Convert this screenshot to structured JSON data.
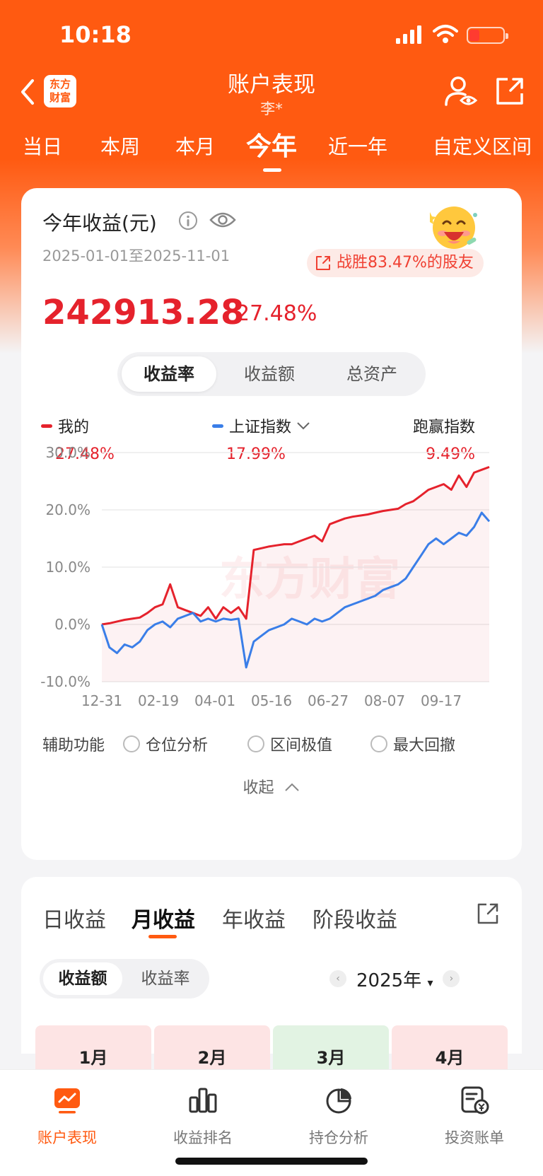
{
  "status": {
    "time": "10:18"
  },
  "header": {
    "logo_line1": "东方",
    "logo_line2": "财富",
    "title": "账户表现",
    "subtitle": "李*"
  },
  "period_tabs": [
    "当日",
    "本周",
    "本月",
    "今年",
    "近一年",
    "自定义区间"
  ],
  "period_tabs_active": "今年",
  "summary": {
    "title": "今年收益(元)",
    "date_range": "2025-01-01至2025-11-01",
    "beat_text": "战胜83.47%的股友",
    "profit": "242913.28",
    "profit_pct": "27.48%"
  },
  "metric_tabs": [
    "收益率",
    "收益额",
    "总资产"
  ],
  "metric_tabs_active": "收益率",
  "legend": {
    "mine_label": "我的",
    "mine_value": "27.48%",
    "index_label": "上证指数",
    "index_value": "17.99%",
    "beat_label": "跑赢指数",
    "beat_value": "9.49%"
  },
  "colors": {
    "accent": "#ff5a11",
    "up_red": "#e5222c",
    "index_blue": "#3a7ee8"
  },
  "chart_data": {
    "type": "line",
    "watermark": "东方财富",
    "x_tick_labels": [
      "12-31",
      "02-19",
      "04-01",
      "05-16",
      "06-27",
      "08-07",
      "09-17"
    ],
    "y_tick_labels": [
      "30.0%",
      "20.0%",
      "10.0%",
      "0.0%",
      "-10.0%"
    ],
    "ylim": [
      -10,
      30
    ],
    "grid": true,
    "series": [
      {
        "name": "我的",
        "color": "#e5222c",
        "values": [
          0,
          0.2,
          0.5,
          0.8,
          1.0,
          1.2,
          2.0,
          3.0,
          3.5,
          7.0,
          3.0,
          2.5,
          2.0,
          1.5,
          3.0,
          1.0,
          3.0,
          2.0,
          3.0,
          1.0,
          13.0,
          13.3,
          13.6,
          13.8,
          14.0,
          14.0,
          14.5,
          15.0,
          15.5,
          14.5,
          17.5,
          18.0,
          18.5,
          18.8,
          19.0,
          19.2,
          19.5,
          19.8,
          20.0,
          20.2,
          21.0,
          21.5,
          22.5,
          23.5,
          24.0,
          24.5,
          23.5,
          26.0,
          24.0,
          26.5,
          27.0,
          27.48
        ]
      },
      {
        "name": "上证指数",
        "color": "#3a7ee8",
        "values": [
          0,
          -4.0,
          -5.0,
          -3.5,
          -4.0,
          -3.0,
          -1.0,
          0,
          0.5,
          -0.5,
          1.0,
          1.5,
          2.0,
          0.5,
          1.0,
          0.5,
          1.0,
          0.8,
          1.0,
          -7.5,
          -3.0,
          -2.0,
          -1.0,
          -0.5,
          0,
          1.0,
          0.5,
          0,
          1.0,
          0.5,
          1.0,
          2.0,
          3.0,
          3.5,
          4.0,
          4.5,
          5.0,
          6.0,
          6.5,
          7.0,
          8.0,
          10.0,
          12.0,
          14.0,
          15.0,
          14.0,
          15.0,
          16.0,
          15.5,
          17.0,
          19.5,
          17.99
        ]
      }
    ]
  },
  "aux": {
    "label": "辅助功能",
    "options": [
      "仓位分析",
      "区间极值",
      "最大回撤"
    ]
  },
  "collapse_label": "收起",
  "returns": {
    "tabs": [
      "日收益",
      "月收益",
      "年收益",
      "阶段收益"
    ],
    "active_tab": "月收益",
    "mode_tabs": [
      "收益额",
      "收益率"
    ],
    "mode_active": "收益额",
    "year": "2025年",
    "months": [
      {
        "label": "1月",
        "bg": "#fde4e4"
      },
      {
        "label": "2月",
        "bg": "#fde4e4"
      },
      {
        "label": "3月",
        "bg": "#e2f3e3"
      },
      {
        "label": "4月",
        "bg": "#fde4e4"
      }
    ]
  },
  "bottom_nav": [
    {
      "label": "账户表现",
      "icon": "performance-icon",
      "active": true
    },
    {
      "label": "收益排名",
      "icon": "ranking-icon",
      "active": false
    },
    {
      "label": "持仓分析",
      "icon": "pie-icon",
      "active": false
    },
    {
      "label": "投资账单",
      "icon": "bill-icon",
      "active": false
    }
  ]
}
